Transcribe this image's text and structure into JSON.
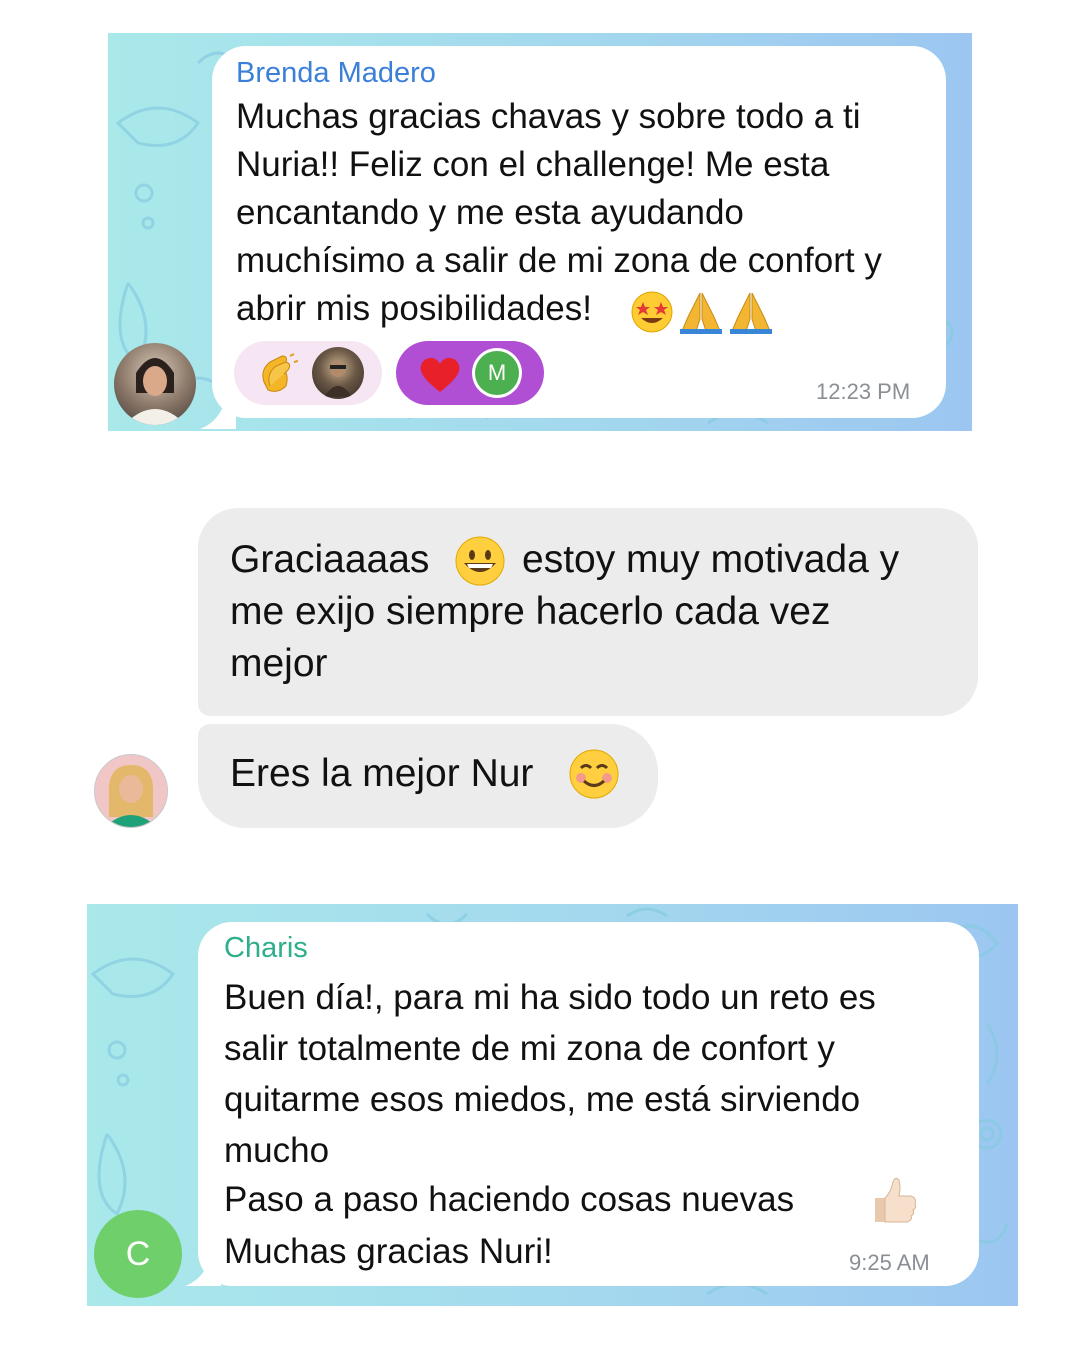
{
  "messages": {
    "brenda": {
      "sender": "Brenda Madero",
      "text": "Muchas gracias chavas y sobre todo a ti\nNuria!! Feliz con el challenge! Me esta\nencantando y me esta ayudando\nmuchísimo a salir de mi zona de confort y\nabrir mis posibilidades!",
      "emojis": [
        "star-struck",
        "folded-hands",
        "folded-hands"
      ],
      "time": "12:23 PM",
      "reactions": [
        {
          "emoji": "clapping-hands",
          "reactor": "photo"
        },
        {
          "emoji": "red-heart",
          "reactor": "M"
        }
      ]
    },
    "outgoing": {
      "line1_a": "Graciaaaas",
      "line1_b": "estoy muy motivada y",
      "line_rest": "me exijo siempre hacerlo cada vez\nmejor",
      "second": "Eres la mejor Nur",
      "emojis": [
        "grinning-face",
        "smiling-face"
      ]
    },
    "charis": {
      "sender": "Charis",
      "avatar_letter": "C",
      "text": "Buen día!, para mi ha sido todo un reto es\nsalir totalmente de mi zona de confort y\nquitarme esos miedos, me está sirviendo\nmucho",
      "line5": "Paso a paso haciendo cosas nuevas",
      "line6": "Muchas gracias Nuri!",
      "emoji": "thumbs-up",
      "time": "9:25 AM"
    }
  },
  "colors": {
    "brenda_name": "#3b7fd8",
    "charis_name": "#2fae8c",
    "charis_avatar": "#6fcf6b",
    "m_badge": "#4caf50",
    "heart_pill": "#b04fd4",
    "clap_pill": "#f6e6f4"
  }
}
